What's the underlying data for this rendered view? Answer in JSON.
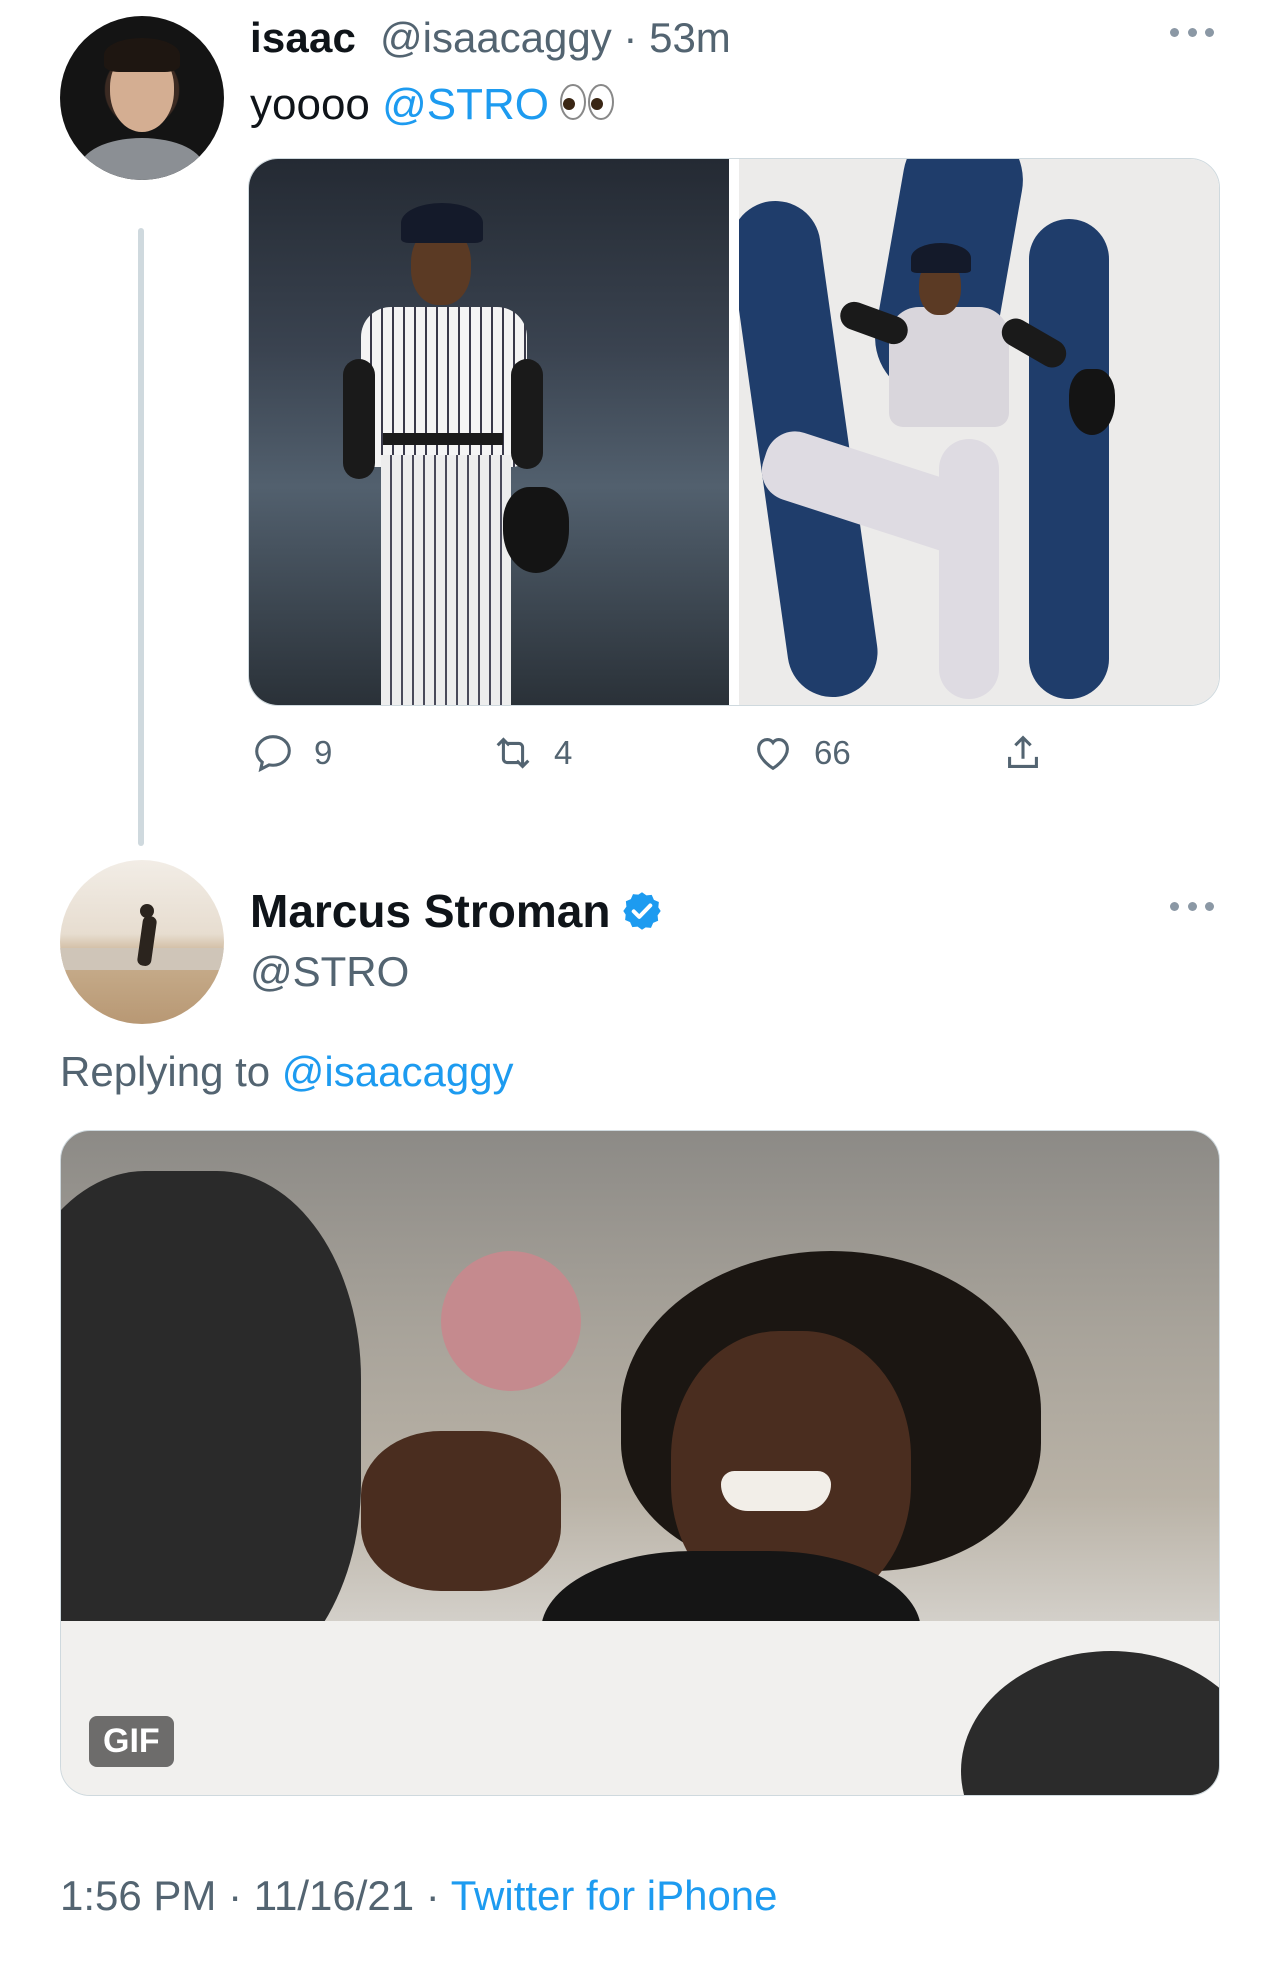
{
  "tweet": {
    "author_name": "isaac",
    "author_handle": "@isaacaggy",
    "separator": " · ",
    "time_ago": "53m",
    "text_prefix": "yoooo ",
    "mention": "@STRO",
    "emoji_icon": "eyes-icon",
    "actions": {
      "replies": "9",
      "retweets": "4",
      "likes": "66"
    }
  },
  "reply": {
    "author_name": "Marcus Stroman",
    "author_handle": "@STRO",
    "verified": true,
    "replying_label": "Replying to ",
    "replying_handle": "@isaacaggy",
    "media_badge": "GIF",
    "timestamp": "1:56 PM",
    "separator": " · ",
    "date": "11/16/21",
    "source": "Twitter for iPhone"
  },
  "colors": {
    "accent": "#1d9bf0",
    "secondary_text": "#536471",
    "primary_text": "#0f1419"
  }
}
